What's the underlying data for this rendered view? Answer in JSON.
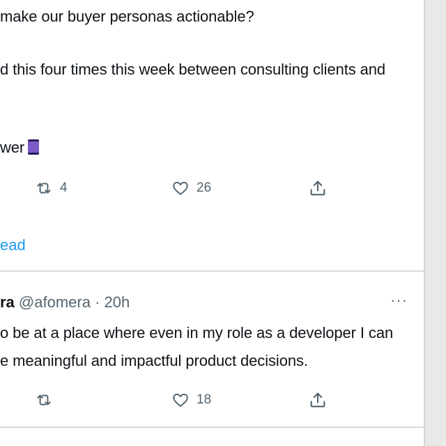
{
  "tweet1": {
    "lines": [
      "make our buyer personas actionable?",
      "d this four times this week between consulting clients and",
      "wer"
    ],
    "emoji_name": "thread-spool-emoji",
    "retweets": "4",
    "likes": "26",
    "show_thread": "ead"
  },
  "tweet2": {
    "name": "ra",
    "handle": "@afomera",
    "separator": "·",
    "time": "20h",
    "more": "···",
    "lines": [
      "o be at a place where even in my role as a developer I can",
      "e meaningful and impactful product decisions."
    ],
    "retweets": "",
    "likes": "18"
  },
  "icons": {
    "retweet": "retweet-icon",
    "like": "heart-icon",
    "share": "share-icon",
    "more": "more-icon"
  },
  "colors": {
    "text": "#0f1419",
    "muted": "#53646f",
    "link": "#1d9bf0",
    "divider": "#d9d9d9"
  }
}
